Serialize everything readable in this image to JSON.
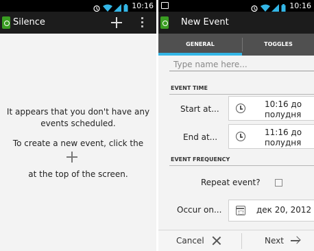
{
  "status_bar": {
    "time": "10:16"
  },
  "left_screen": {
    "app_title": "Silence",
    "empty_line1": "It appears that you don't have any",
    "empty_line2": "events scheduled.",
    "create_line": "To create a new event, click the",
    "bottom_line": "at the top of the screen."
  },
  "right_screen": {
    "title": "New Event",
    "tabs": [
      {
        "label": "GENERAL"
      },
      {
        "label": "TOGGLES"
      }
    ],
    "name_placeholder": "Type name here...",
    "event_time_header": "EVENT TIME",
    "start_label": "Start at...",
    "start_value_line1": "10:16 до",
    "start_value_line2": "полудня",
    "end_label": "End at...",
    "end_value_line1": "11:16 до",
    "end_value_line2": "полудня",
    "frequency_header": "EVENT FREQUENCY",
    "repeat_label": "Repeat event?",
    "occur_label": "Occur on...",
    "occur_value": "дек 20, 2012",
    "cancel_label": "Cancel",
    "next_label": "Next"
  },
  "colors": {
    "accent": "#33b5e5",
    "app_icon": "#3a9d22",
    "action_bar": "#1c1c1c",
    "tab_bar": "#505050"
  }
}
